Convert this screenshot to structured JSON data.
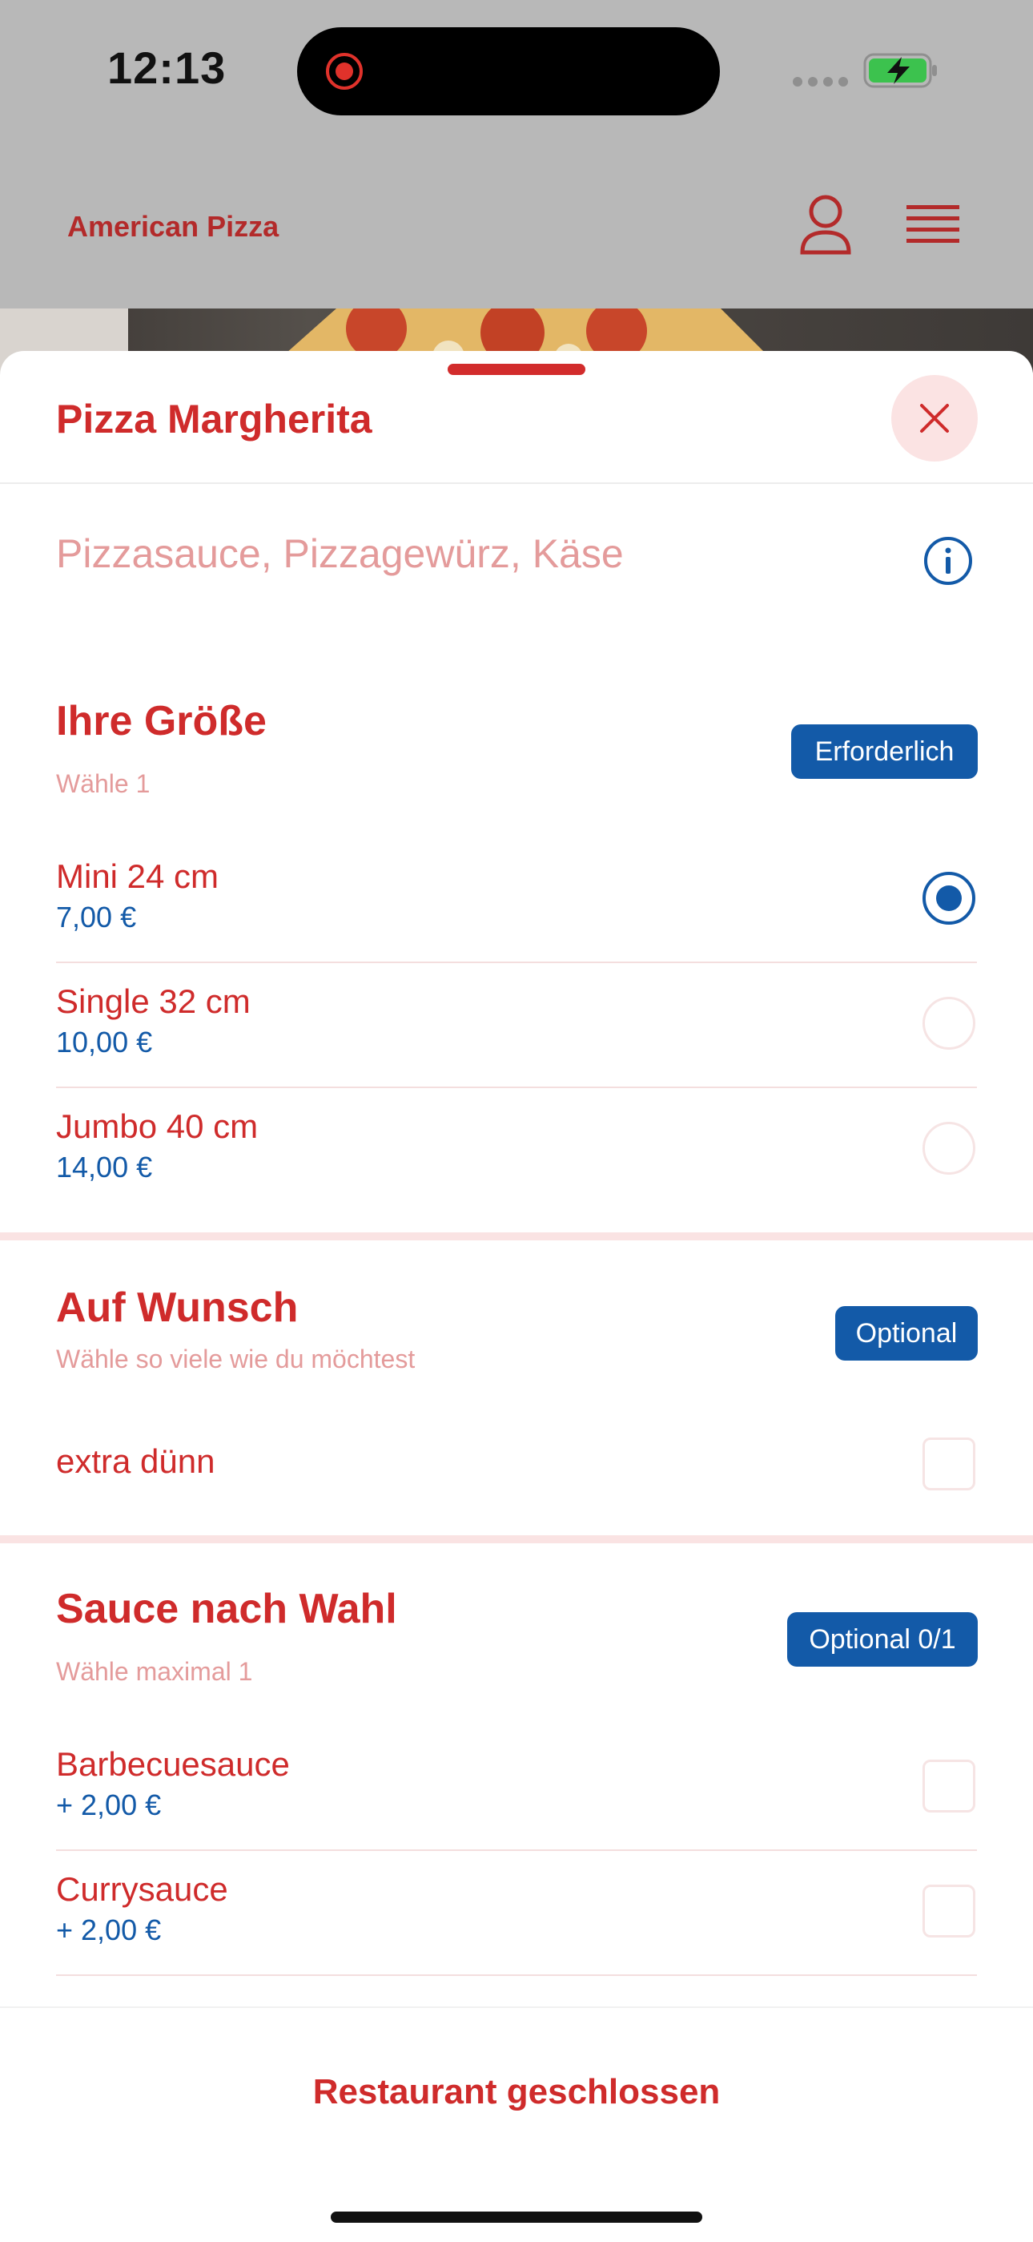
{
  "status": {
    "time": "12:13"
  },
  "header": {
    "title": "American Pizza"
  },
  "sheet": {
    "title": "Pizza Margherita",
    "description": "Pizzasauce, Pizzagewürz, Käse"
  },
  "groups": [
    {
      "title": "Ihre Größe",
      "subtitle": "Wähle 1",
      "badge": "Erforderlich",
      "options": [
        {
          "label": "Mini 24 cm",
          "price": "7,00 €",
          "selected": true
        },
        {
          "label": "Single 32 cm",
          "price": "10,00 €",
          "selected": false
        },
        {
          "label": "Jumbo 40 cm",
          "price": "14,00 €",
          "selected": false
        }
      ]
    },
    {
      "title": "Auf Wunsch",
      "subtitle": "Wähle so viele wie du möchtest",
      "badge": "Optional",
      "options": [
        {
          "label": "extra dünn",
          "checked": false
        }
      ]
    },
    {
      "title": "Sauce nach Wahl",
      "subtitle": "Wähle maximal 1",
      "badge": "Optional 0/1",
      "options": [
        {
          "label": "Barbecuesauce",
          "price": "+ 2,00 €",
          "checked": false
        },
        {
          "label": "Currysauce",
          "price": "+ 2,00 €",
          "checked": false
        }
      ]
    }
  ],
  "footer": {
    "status": "Restaurant geschlossen"
  },
  "colors": {
    "brand_red": "#cf2b2b",
    "accent_blue": "#135aa8",
    "muted_pink": "#e49b9b"
  }
}
